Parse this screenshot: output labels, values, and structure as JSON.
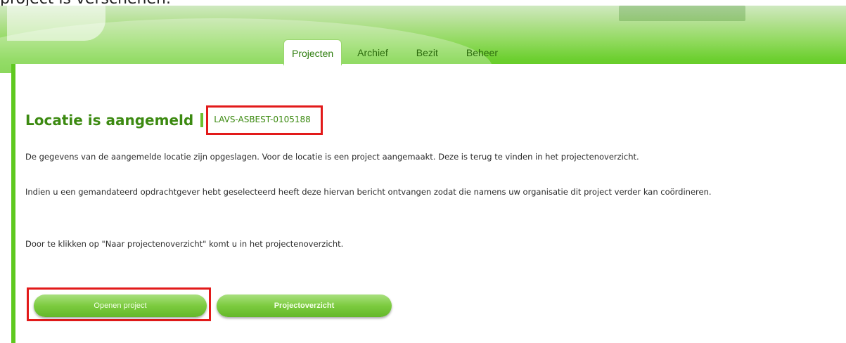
{
  "caption": "project is verschenen.",
  "tabs": [
    {
      "label": "Projecten",
      "active": true
    },
    {
      "label": "Archief",
      "active": false
    },
    {
      "label": "Bezit",
      "active": false
    },
    {
      "label": "Beheer",
      "active": false
    }
  ],
  "page": {
    "title": "Locatie is aangemeld",
    "project_code": "LAVS-ASBEST-0105188",
    "paragraphs": [
      "De gegevens van de aangemelde locatie zijn opgeslagen. Voor de locatie is een project aangemaakt. Deze is terug te vinden in het projectenoverzicht.",
      "Indien u een gemandateerd opdrachtgever hebt geselecteerd heeft deze hiervan bericht ontvangen zodat die namens uw organisatie dit project verder kan coördineren.",
      "Door te klikken op \"Naar projectenoverzicht\" komt u in het projectenoverzicht."
    ]
  },
  "buttons": {
    "open_project": "Openen project",
    "project_overview": "Projectoverzicht"
  },
  "colors": {
    "brand_green": "#5fc91f",
    "title_green": "#3c8a11",
    "highlight_red": "#e21a1a"
  }
}
